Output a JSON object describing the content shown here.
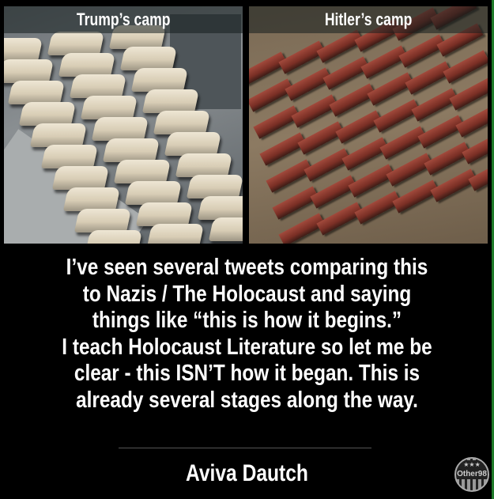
{
  "panels": {
    "left_caption": "Trump’s camp",
    "right_caption": "Hitler’s camp"
  },
  "quote": {
    "lines": [
      "I’ve seen several tweets comparing this",
      "to Nazis / The Holocaust and saying",
      "things like “this is how it begins.”",
      "I teach Holocaust Literature so let me be",
      "clear - this ISN’T how it began. This is",
      "already several stages along the way."
    ]
  },
  "author": "Aviva Dautch",
  "logo": {
    "text": "Other98",
    "stars": "★★★"
  },
  "colors": {
    "background": "#000000",
    "text": "#ffffff",
    "border": "#1f7a2a"
  }
}
